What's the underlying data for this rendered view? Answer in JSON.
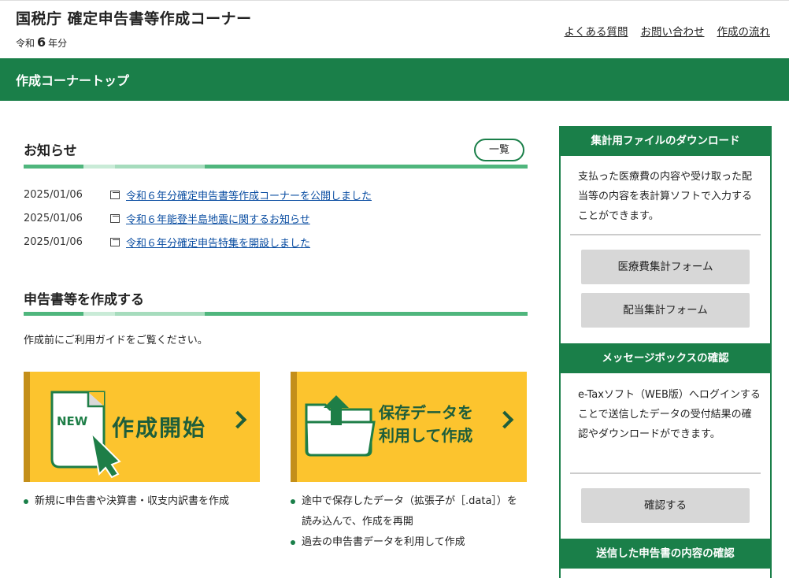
{
  "header": {
    "title": "国税庁 確定申告書等作成コーナー",
    "year_prefix": "令和",
    "year_num": "6",
    "year_suffix": "年分",
    "links": [
      "よくある質問",
      "お問い合わせ",
      "作成の流れ"
    ]
  },
  "greenbar": {
    "label": "作成コーナートップ"
  },
  "notices": {
    "heading": "お知らせ",
    "list_button": "一覧",
    "items": [
      {
        "date": "2025/01/06",
        "text": "令和６年分確定申告書等作成コーナーを公開しました"
      },
      {
        "date": "2025/01/06",
        "text": "令和６年能登半島地震に関するお知らせ"
      },
      {
        "date": "2025/01/06",
        "text": "令和６年分確定申告特集を開設しました"
      }
    ]
  },
  "create": {
    "heading": "申告書等を作成する",
    "guide": "作成前にご利用ガイドをご覧ください。",
    "start_button": {
      "label": "作成開始",
      "icon_text": "NEW"
    },
    "saved_button": {
      "line1": "保存データを",
      "line2": "利用して作成"
    },
    "start_bullets": [
      "新規に申告書や決算書・収支内訳書を作成"
    ],
    "saved_bullets": [
      "途中で保存したデータ（拡張子が［.data］）を読み込んで、作成を再開",
      "過去の申告書データを利用して作成"
    ]
  },
  "sidebar": {
    "section1": {
      "title": "集計用ファイルのダウンロード",
      "text": "支払った医療費の内容や受け取った配当等の内容を表計算ソフトで入力することができます。",
      "buttons": [
        "医療費集計フォーム",
        "配当集計フォーム"
      ]
    },
    "section2": {
      "title": "メッセージボックスの確認",
      "text": "e-Taxソフト（WEB版）へログインすることで送信したデータの受付結果の確認やダウンロードができます。",
      "button": "確認する"
    },
    "section3": {
      "title": "送信した申告書の内容の確認"
    }
  },
  "colors": {
    "brand_green": "#1a7f49",
    "button_yellow": "#fcc42e",
    "button_green_text": "#1e5e3b"
  }
}
